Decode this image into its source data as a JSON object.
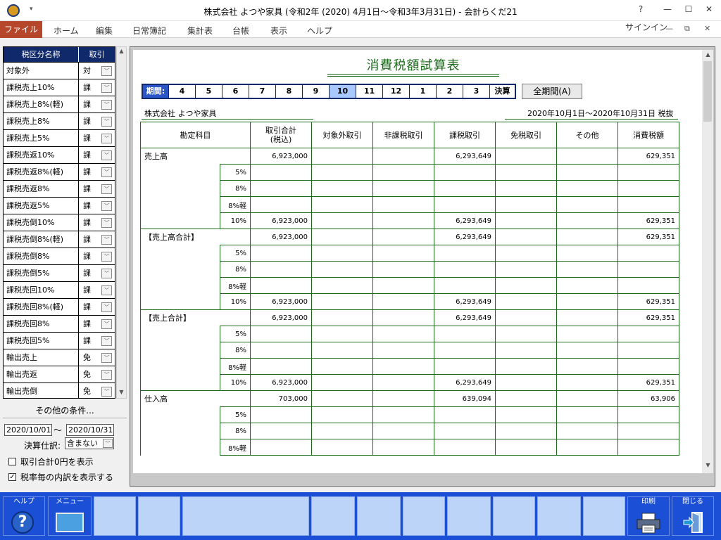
{
  "window": {
    "title": "株式会社 よつや家具 (令和2年 (2020) 4月1日～令和3年3月31日) - 会計らくだ21",
    "help": "?",
    "minimize": "—",
    "maximize": "☐",
    "close": "✕"
  },
  "ribbon": {
    "file": "ファイル",
    "tabs": [
      "ホーム",
      "編集",
      "日常簿記",
      "集計表",
      "台帳",
      "表示",
      "ヘルプ"
    ],
    "signin": "サインイン",
    "min": "—",
    "restore": "⧉",
    "close": "✕"
  },
  "left": {
    "header_name": "税区分名称",
    "header_trade": "取引",
    "rows": [
      {
        "name": "対象外",
        "code": "対"
      },
      {
        "name": "課税売上10%",
        "code": "課"
      },
      {
        "name": "課税売上8%(軽)",
        "code": "課"
      },
      {
        "name": "課税売上8%",
        "code": "課"
      },
      {
        "name": "課税売上5%",
        "code": "課"
      },
      {
        "name": "課税売返10%",
        "code": "課"
      },
      {
        "name": "課税売返8%(軽)",
        "code": "課"
      },
      {
        "name": "課税売返8%",
        "code": "課"
      },
      {
        "name": "課税売返5%",
        "code": "課"
      },
      {
        "name": "課税売倒10%",
        "code": "課"
      },
      {
        "name": "課税売倒8%(軽)",
        "code": "課"
      },
      {
        "name": "課税売倒8%",
        "code": "課"
      },
      {
        "name": "課税売倒5%",
        "code": "課"
      },
      {
        "name": "課税売回10%",
        "code": "課"
      },
      {
        "name": "課税売回8%(軽)",
        "code": "課"
      },
      {
        "name": "課税売回8%",
        "code": "課"
      },
      {
        "name": "課税売回5%",
        "code": "課"
      },
      {
        "name": "輸出売上",
        "code": "免"
      },
      {
        "name": "輸出売返",
        "code": "免"
      },
      {
        "name": "輸出売倒",
        "code": "免"
      }
    ],
    "other_conditions": "その他の条件...",
    "date_from": "2020/10/01",
    "tilde": "～",
    "date_to": "2020/10/31",
    "closing_label": "決算仕訳:",
    "closing_value": "含まない",
    "check_zero_label": "取引合計0円を表示",
    "check_zero": false,
    "check_rate_label": "税率毎の内訳を表示する",
    "check_rate": true
  },
  "report": {
    "title": "消費税額試算表",
    "period_label": "期間:",
    "periods": [
      "4",
      "5",
      "6",
      "7",
      "8",
      "9",
      "10",
      "11",
      "12",
      "1",
      "2",
      "3",
      "決算"
    ],
    "active_period": "10",
    "full_period_button": "全期間(A)",
    "company": "株式会社 よつや家具",
    "period_range": "2020年10月1日～2020年10月31日 税抜",
    "columns": [
      "勘定科目",
      "取引合計\n(税込)",
      "対象外取引",
      "非課税取引",
      "課税取引",
      "免税取引",
      "その他",
      "消費税額"
    ],
    "sections": [
      {
        "account": "売上高",
        "total": {
          "gross": "6,923,000",
          "taxable": "6,293,649",
          "tax": "629,351"
        },
        "rates": [
          {
            "rate": "5%",
            "gross": "",
            "taxable": "",
            "tax": ""
          },
          {
            "rate": "8%",
            "gross": "",
            "taxable": "",
            "tax": ""
          },
          {
            "rate": "8%軽",
            "gross": "",
            "taxable": "",
            "tax": ""
          },
          {
            "rate": "10%",
            "gross": "6,923,000",
            "taxable": "6,293,649",
            "tax": "629,351"
          }
        ]
      },
      {
        "account": "【売上高合計】",
        "total": {
          "gross": "6,923,000",
          "taxable": "6,293,649",
          "tax": "629,351"
        },
        "rates": [
          {
            "rate": "5%",
            "gross": "",
            "taxable": "",
            "tax": ""
          },
          {
            "rate": "8%",
            "gross": "",
            "taxable": "",
            "tax": ""
          },
          {
            "rate": "8%軽",
            "gross": "",
            "taxable": "",
            "tax": ""
          },
          {
            "rate": "10%",
            "gross": "6,923,000",
            "taxable": "6,293,649",
            "tax": "629,351"
          }
        ]
      },
      {
        "account": "【売上合計】",
        "total": {
          "gross": "6,923,000",
          "taxable": "6,293,649",
          "tax": "629,351"
        },
        "rates": [
          {
            "rate": "5%",
            "gross": "",
            "taxable": "",
            "tax": ""
          },
          {
            "rate": "8%",
            "gross": "",
            "taxable": "",
            "tax": ""
          },
          {
            "rate": "8%軽",
            "gross": "",
            "taxable": "",
            "tax": ""
          },
          {
            "rate": "10%",
            "gross": "6,923,000",
            "taxable": "6,293,649",
            "tax": "629,351"
          }
        ]
      },
      {
        "account": "仕入高",
        "total": {
          "gross": "703,000",
          "taxable": "639,094",
          "tax": "63,906"
        },
        "rates": [
          {
            "rate": "5%",
            "gross": "",
            "taxable": "",
            "tax": ""
          },
          {
            "rate": "8%",
            "gross": "",
            "taxable": "",
            "tax": ""
          },
          {
            "rate": "8%軽",
            "gross": "",
            "taxable": "",
            "tax": ""
          }
        ]
      }
    ]
  },
  "bottom": {
    "help_label": "ヘルプ",
    "menu_label": "メニュー",
    "print_label": "印刷",
    "close_label": "閉じる",
    "help_glyph": "?"
  }
}
